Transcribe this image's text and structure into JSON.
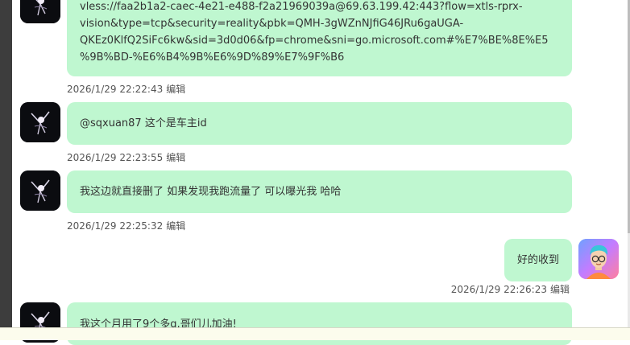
{
  "edit_label": "编辑",
  "messages": [
    {
      "sender": "other",
      "text_lines": [
        "vless://faa2b1a2-caec-4e21-e488-f2a21969039a@69.63.199.42:443?flow=xtls-rprx-",
        "vision&type=tcp&security=reality&pbk=QMH-3gWZnNJfiG46JRu6gaUGA-",
        "QKEz0KlfQ2SiFc6kw&sid=3d0d06&fp=chrome&sni=go.microsoft.com#%E7%BE%8E%E5",
        "%9B%BD-%E6%B4%9B%E6%9D%89%E7%9F%B6"
      ],
      "timestamp": "2026/1/29 22:22:43"
    },
    {
      "sender": "other",
      "text": "@sqxuan87 这个是车主id",
      "timestamp": "2026/1/29 22:23:55"
    },
    {
      "sender": "other",
      "text": "我这边就直接删了 如果发现我跑流量了 可以曝光我 哈哈",
      "timestamp": "2026/1/29 22:25:32"
    },
    {
      "sender": "me",
      "text": "好的收到",
      "timestamp": "2026/1/29 22:26:23"
    },
    {
      "sender": "other",
      "text": "我这个月用了9个多g,哥们儿加油!",
      "timestamp": ""
    }
  ],
  "colors": {
    "bubble": "#bff7d0",
    "meta_text": "#555555",
    "left_rail": "#3d3d3d"
  },
  "icons": {
    "other_avatar": "dark-figure-avatar",
    "me_avatar": "cartoon-man-glasses-avatar"
  }
}
